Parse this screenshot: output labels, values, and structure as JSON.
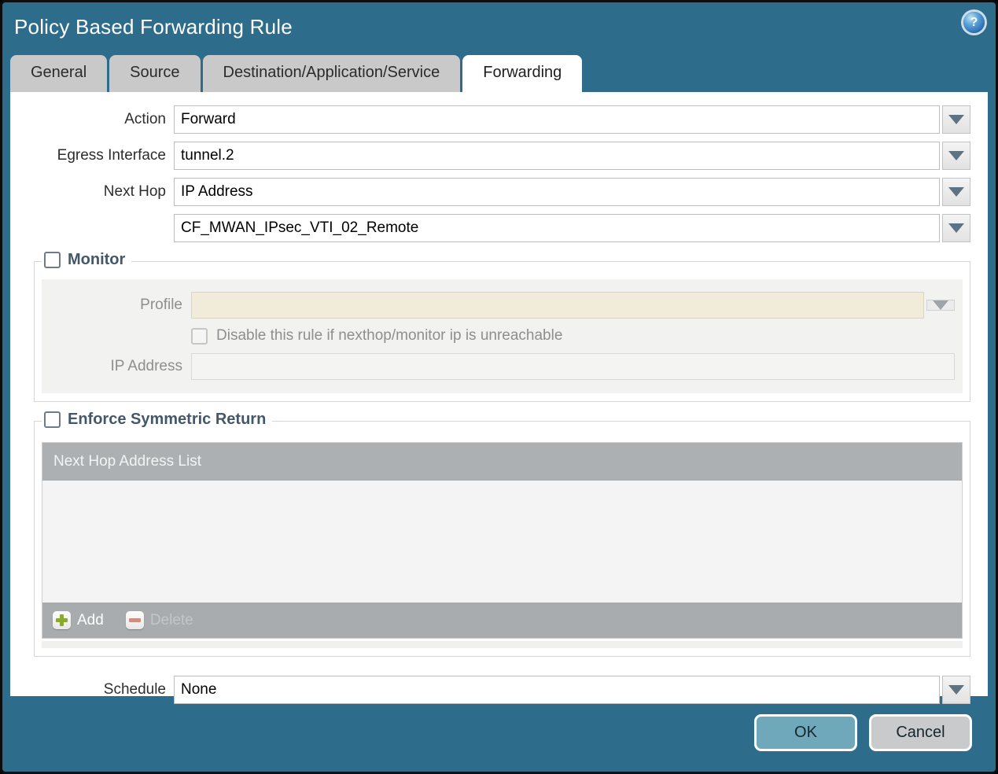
{
  "window": {
    "title": "Policy Based Forwarding Rule",
    "help_glyph": "?",
    "accent_color": "#2e6c8b"
  },
  "tabs": [
    {
      "label": "General",
      "active": false
    },
    {
      "label": "Source",
      "active": false
    },
    {
      "label": "Destination/Application/Service",
      "active": false
    },
    {
      "label": "Forwarding",
      "active": true
    }
  ],
  "form": {
    "action": {
      "label": "Action",
      "value": "Forward"
    },
    "egress_interface": {
      "label": "Egress Interface",
      "value": "tunnel.2"
    },
    "next_hop": {
      "label": "Next Hop",
      "value": "IP Address"
    },
    "next_hop_address": {
      "value": "CF_MWAN_IPsec_VTI_02_Remote"
    },
    "schedule": {
      "label": "Schedule",
      "value": "None"
    }
  },
  "monitor": {
    "title": "Monitor",
    "checked": false,
    "profile": {
      "label": "Profile",
      "value": ""
    },
    "disable_rule": {
      "label": "Disable this rule if nexthop/monitor ip is unreachable",
      "checked": false
    },
    "ip_address": {
      "label": "IP Address",
      "value": ""
    }
  },
  "enforce_symmetric_return": {
    "title": "Enforce Symmetric Return",
    "checked": false,
    "table": {
      "header": "Next Hop Address List",
      "rows": [],
      "add_label": "Add",
      "delete_label": "Delete",
      "delete_enabled": false
    }
  },
  "footer": {
    "ok_label": "OK",
    "cancel_label": "Cancel"
  }
}
